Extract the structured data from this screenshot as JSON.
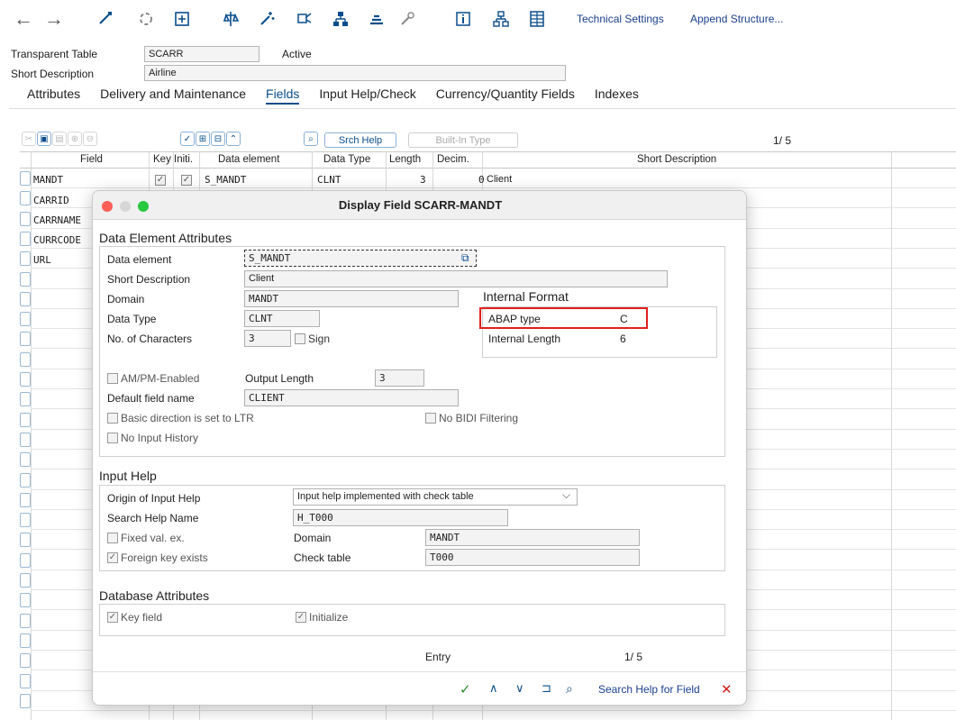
{
  "toolbar": {
    "back_icon": "arrow-left-icon",
    "forward_icon": "arrow-right-icon",
    "technical_settings": "Technical Settings",
    "append_structure": "Append Structure..."
  },
  "header": {
    "table_label": "Transparent Table",
    "table_value": "SCARR",
    "status": "Active",
    "short_desc_label": "Short Description",
    "short_desc_value": "Airline"
  },
  "tabs": [
    {
      "label": "Attributes"
    },
    {
      "label": "Delivery and Maintenance"
    },
    {
      "label": "Fields"
    },
    {
      "label": "Input Help/Check"
    },
    {
      "label": "Currency/Quantity Fields"
    },
    {
      "label": "Indexes"
    }
  ],
  "table_toolbar": {
    "srch_help": "Srch Help",
    "builtin_type": "Built-In Type",
    "pager": "1/ 5"
  },
  "columns": {
    "field": "Field",
    "key": "Key",
    "initial": "Initi.",
    "data_element": "Data element",
    "data_type": "Data Type",
    "length": "Length",
    "decimals": "Decim.",
    "short_description": "Short Description"
  },
  "rows": [
    {
      "field": "MANDT",
      "data_element": "S_MANDT",
      "data_type": "CLNT",
      "length": "3",
      "decimals": "0",
      "short_description": "Client"
    },
    {
      "field": "CARRID"
    },
    {
      "field": "CARRNAME"
    },
    {
      "field": "CURRCODE"
    },
    {
      "field": "URL"
    }
  ],
  "dialog": {
    "title": "Display Field SCARR-MANDT",
    "data_element_section": "Data Element Attributes",
    "data_element_label": "Data element",
    "data_element_value": "S_MANDT",
    "short_desc_label": "Short Description",
    "short_desc_value": "Client",
    "domain_label": "Domain",
    "domain_value": "MANDT",
    "data_type_label": "Data Type",
    "data_type_value": "CLNT",
    "num_chars_label": "No. of Characters",
    "num_chars_value": "3",
    "sign_label": "Sign",
    "internal_format_title": "Internal Format",
    "abap_type_label": "ABAP type",
    "abap_type_value": "C",
    "internal_length_label": "Internal Length",
    "internal_length_value": "6",
    "ampm_label": "AM/PM-Enabled",
    "output_length_label": "Output Length",
    "output_length_value": "3",
    "default_field_name_label": "Default field name",
    "default_field_name_value": "CLIENT",
    "ltr_label": "Basic direction is set to LTR",
    "no_bidi_label": "No BIDI Filtering",
    "no_input_history_label": "No Input History",
    "input_help_section": "Input Help",
    "origin_label": "Origin of Input Help",
    "origin_value": "Input help implemented with check table",
    "search_help_name_label": "Search Help Name",
    "search_help_name_value": "H_T000",
    "fixed_val_label": "Fixed val. ex.",
    "domain2_label": "Domain",
    "domain2_value": "MANDT",
    "foreign_key_label": "Foreign key exists",
    "check_table_label": "Check table",
    "check_table_value": "T000",
    "db_section": "Database Attributes",
    "key_field_label": "Key field",
    "initialize_label": "Initialize",
    "entry_label": "Entry",
    "entry_pager": "1/ 5",
    "search_help_for_field": "Search Help for Field"
  },
  "colors": {
    "accent": "#0a4d8c",
    "highlight": "#e0201c",
    "confirm": "#2e8b2e",
    "cancel": "#d0201c"
  }
}
